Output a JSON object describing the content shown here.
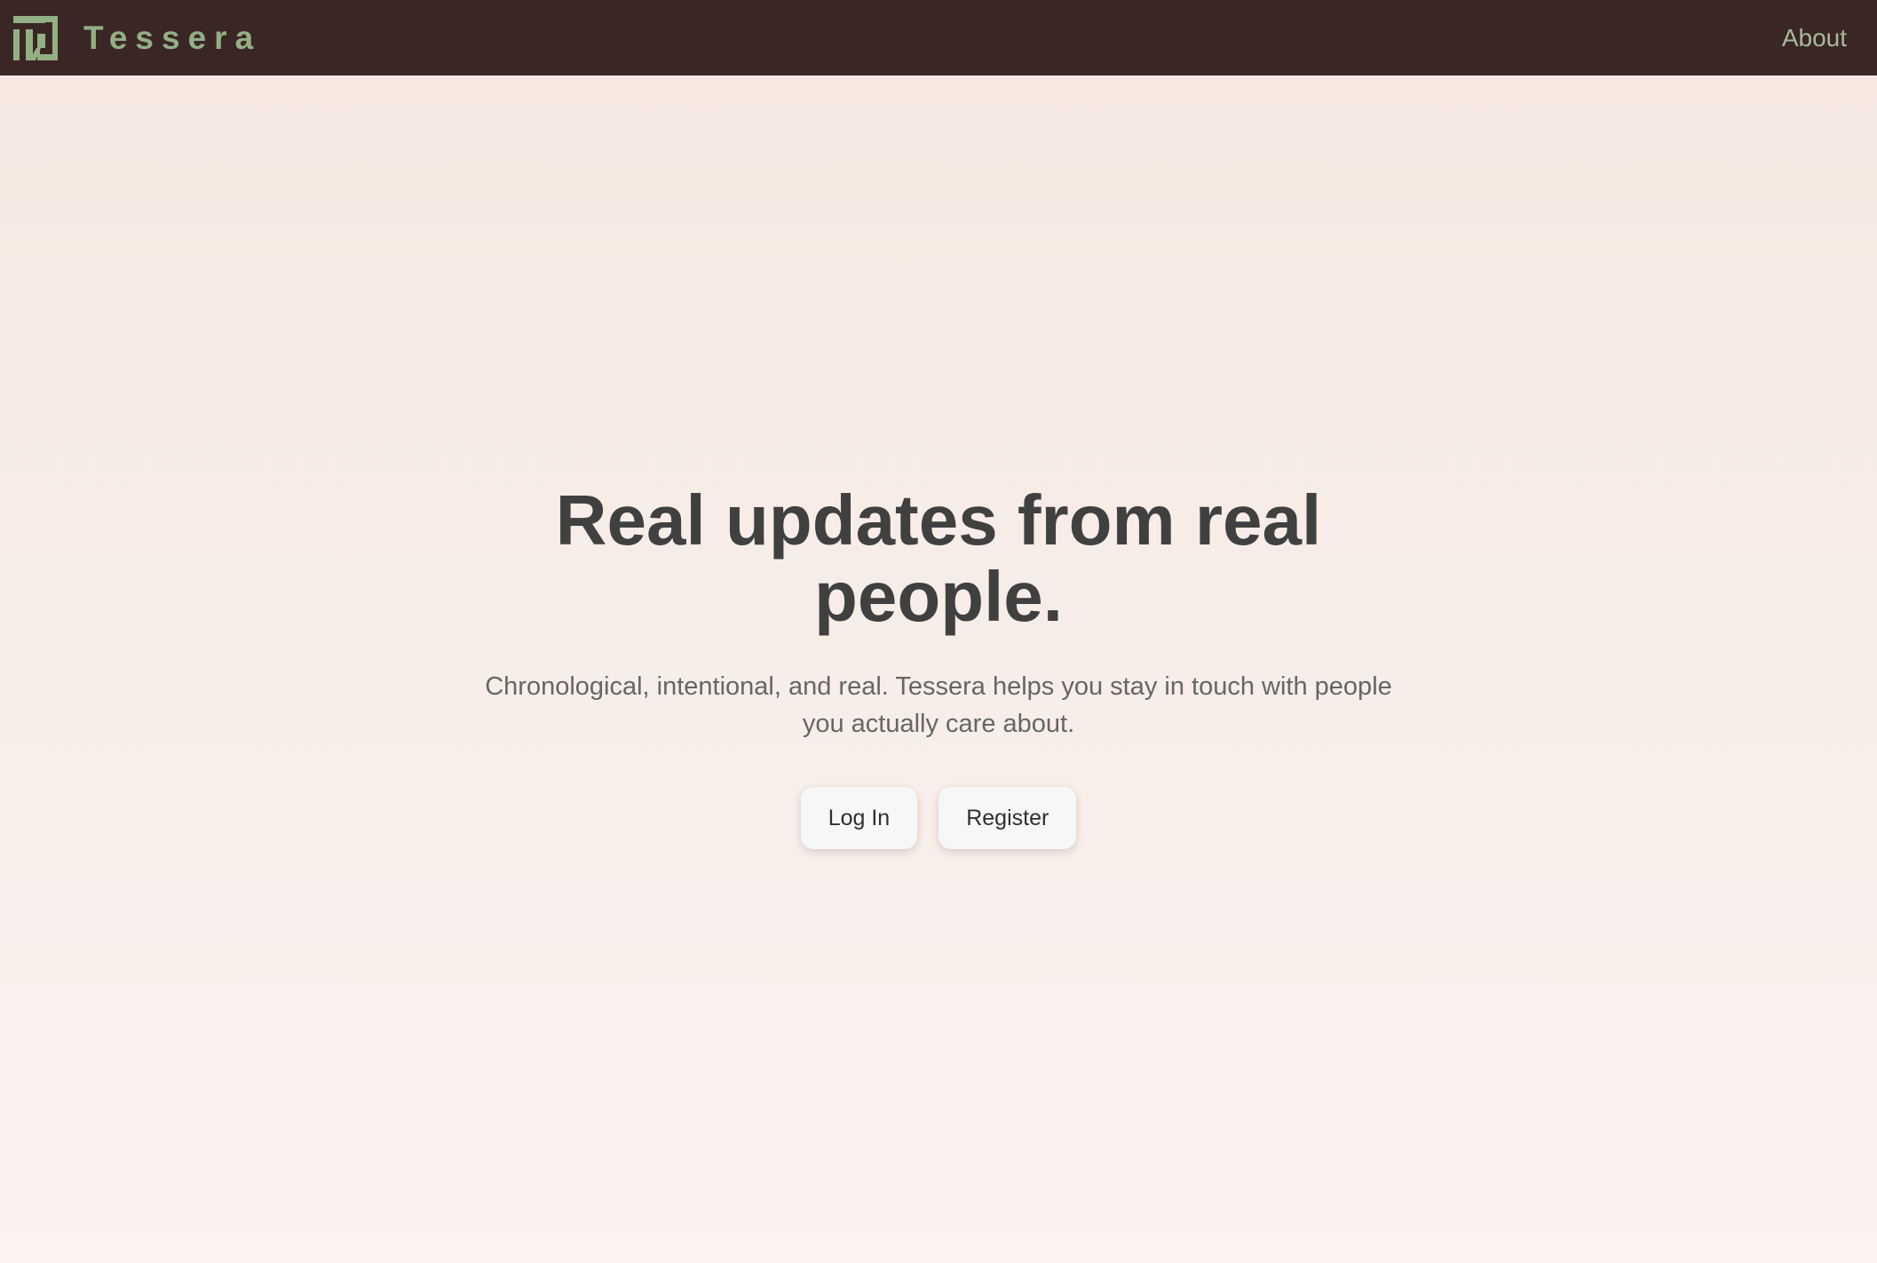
{
  "nav": {
    "brand": "Tessera",
    "about_label": "About",
    "logo_icon": "tessera-logo-icon"
  },
  "hero": {
    "headline": "Real updates from real people.",
    "subtitle": "Chronological, intentional, and real. Tessera helps you stay in touch with people you actually care about."
  },
  "actions": {
    "login_label": "Log In",
    "register_label": "Register"
  },
  "colors": {
    "nav_background": "#3b2626",
    "brand_green": "#93b084",
    "page_background_top": "#f6e7e0",
    "page_background_bottom": "#fbf3f0",
    "headline_text": "#404040",
    "subtitle_text": "#666666",
    "button_background": "#f7f7f7"
  }
}
